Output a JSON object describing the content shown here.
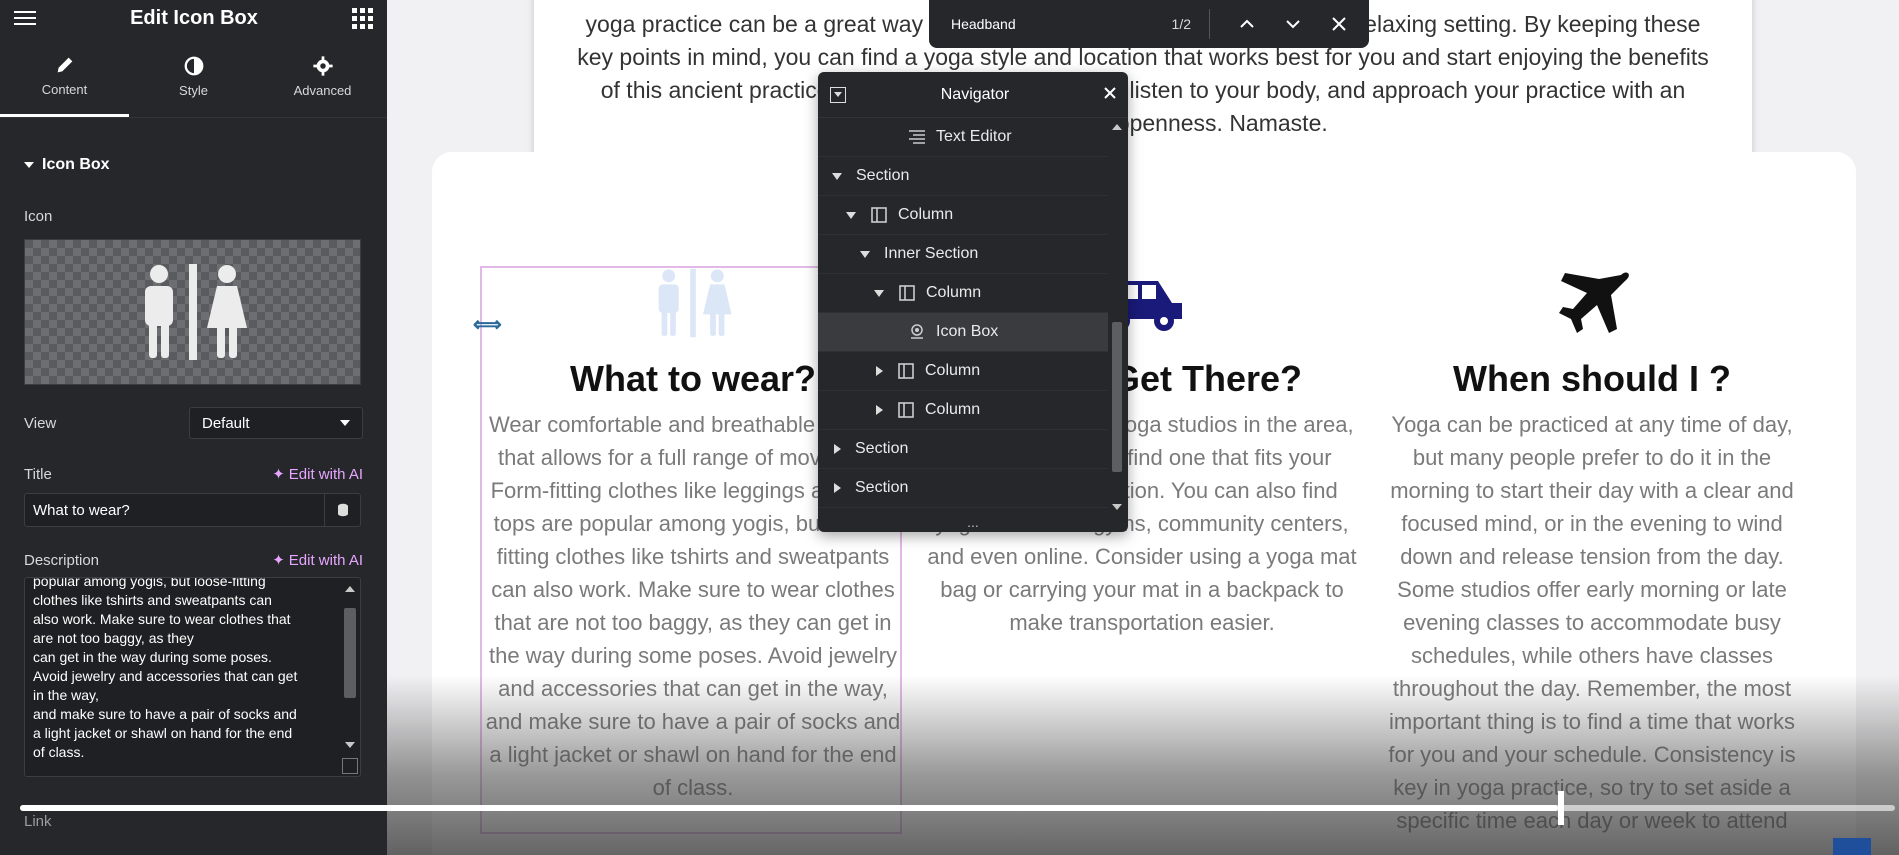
{
  "panel": {
    "title": "Edit Icon Box",
    "tabs": [
      {
        "label": "Content",
        "icon": "pencil-icon"
      },
      {
        "label": "Style",
        "icon": "half-circle-icon"
      },
      {
        "label": "Advanced",
        "icon": "gear-icon"
      }
    ],
    "section_title": "Icon Box",
    "icon_label": "Icon",
    "view_label": "View",
    "view_value": "Default",
    "title_label": "Title",
    "edit_ai": "Edit with AI",
    "title_value": "What to wear?",
    "description_label": "Description",
    "description_value": "popular among yogis, but loose-fitting\nclothes like tshirts and sweatpants can\nalso work. Make sure to wear clothes that\nare not too baggy, as they\ncan get in the way during some poses.\nAvoid jewelry and accessories that can get\nin the way,\nand make sure to have a pair of socks and\na light jacket or shawl on hand for the end\nof class.",
    "link_label": "Link"
  },
  "findbar": {
    "query": "Headband",
    "count": "1/2"
  },
  "navigator": {
    "title": "Navigator",
    "items": [
      {
        "label": "Text Editor"
      },
      {
        "label": "Section"
      },
      {
        "label": "Column"
      },
      {
        "label": "Inner Section"
      },
      {
        "label": "Column"
      },
      {
        "label": "Icon Box"
      },
      {
        "label": "Column"
      },
      {
        "label": "Column"
      },
      {
        "label": "Section"
      },
      {
        "label": "Section"
      }
    ],
    "more": "..."
  },
  "canvas": {
    "intro_text": "yoga practice can be a great way to relax, get fit, and meet new people in a relaxing setting. By keeping these key points in mind, you can find a yoga style and location that works best for you and start enjoying the benefits of this ancient practice. Remember to take it slowly, listen to your body, and approach your practice with an open mind and openness. Namaste.",
    "columns": [
      {
        "icon": "restroom-icon",
        "title": "What to wear?",
        "text": "Wear comfortable and breathable clothing that allows for a full range of movement. Form-fitting clothes like leggings and tank tops are popular among yogis, but loose-fitting clothes like tshirts and sweatpants can also work. Make sure to wear clothes that are not too baggy, as they can get in the way during some poses. Avoid jewelry and accessories that can get in the way, and make sure to have a pair of socks and a light jacket or shawl on hand for the end of class."
      },
      {
        "icon": "car-icon",
        "title": "How to Get There?",
        "text": "There are multiple yoga studios in the area, so you can easily find one that fits your schedule and location. You can also find yoga classes at gyms, community centers, and even online. Consider using a yoga mat bag or carrying your mat in a backpack to make transportation easier."
      },
      {
        "icon": "plane-icon",
        "title": "When should I ?",
        "text": "Yoga can be practiced at any time of day, but many people prefer to do it in the morning to start their day with a clear and focused mind, or in the evening to wind down and release tension from the day. Some studios offer early morning or late evening classes to accommodate busy schedules, while others have classes throughout the day. Remember, the most important thing is to find a time that works for you and your schedule. Consistency is key in yoga practice, so try to set aside a specific time each day or week to attend"
      }
    ]
  },
  "player": {
    "progress": 0.82
  },
  "colors": {
    "accent_icon_light": "#dbe6f7",
    "car_icon": "#1a1a7a",
    "selection_border": "#e2b9e6",
    "ai_purple": "#e6a6ff"
  }
}
